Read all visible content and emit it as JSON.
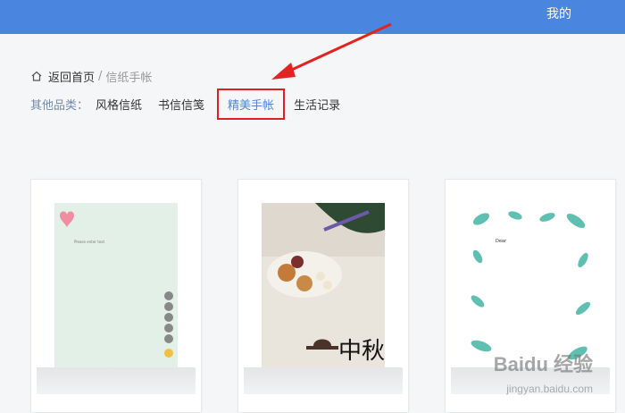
{
  "header": {
    "me_label": "我的"
  },
  "breadcrumb": {
    "home": "返回首页",
    "separator": "/",
    "current": "信纸手帐"
  },
  "categories": {
    "label": "其他品类：",
    "items": [
      "风格信纸",
      "书信信笺",
      "精美手帐",
      "生活记录"
    ],
    "active_index": 2
  },
  "cards": [
    {
      "name": "green-letter-paper"
    },
    {
      "name": "mid-autumn-letter-paper",
      "art_text": "中秋"
    },
    {
      "name": "leaf-border-letter-paper"
    }
  ],
  "watermark": {
    "brand": "Baidu 经验",
    "url": "jingyan.baidu.com"
  },
  "colors": {
    "header": "#4a86e0",
    "active": "#4a86e0",
    "highlight_box": "#e02020"
  }
}
